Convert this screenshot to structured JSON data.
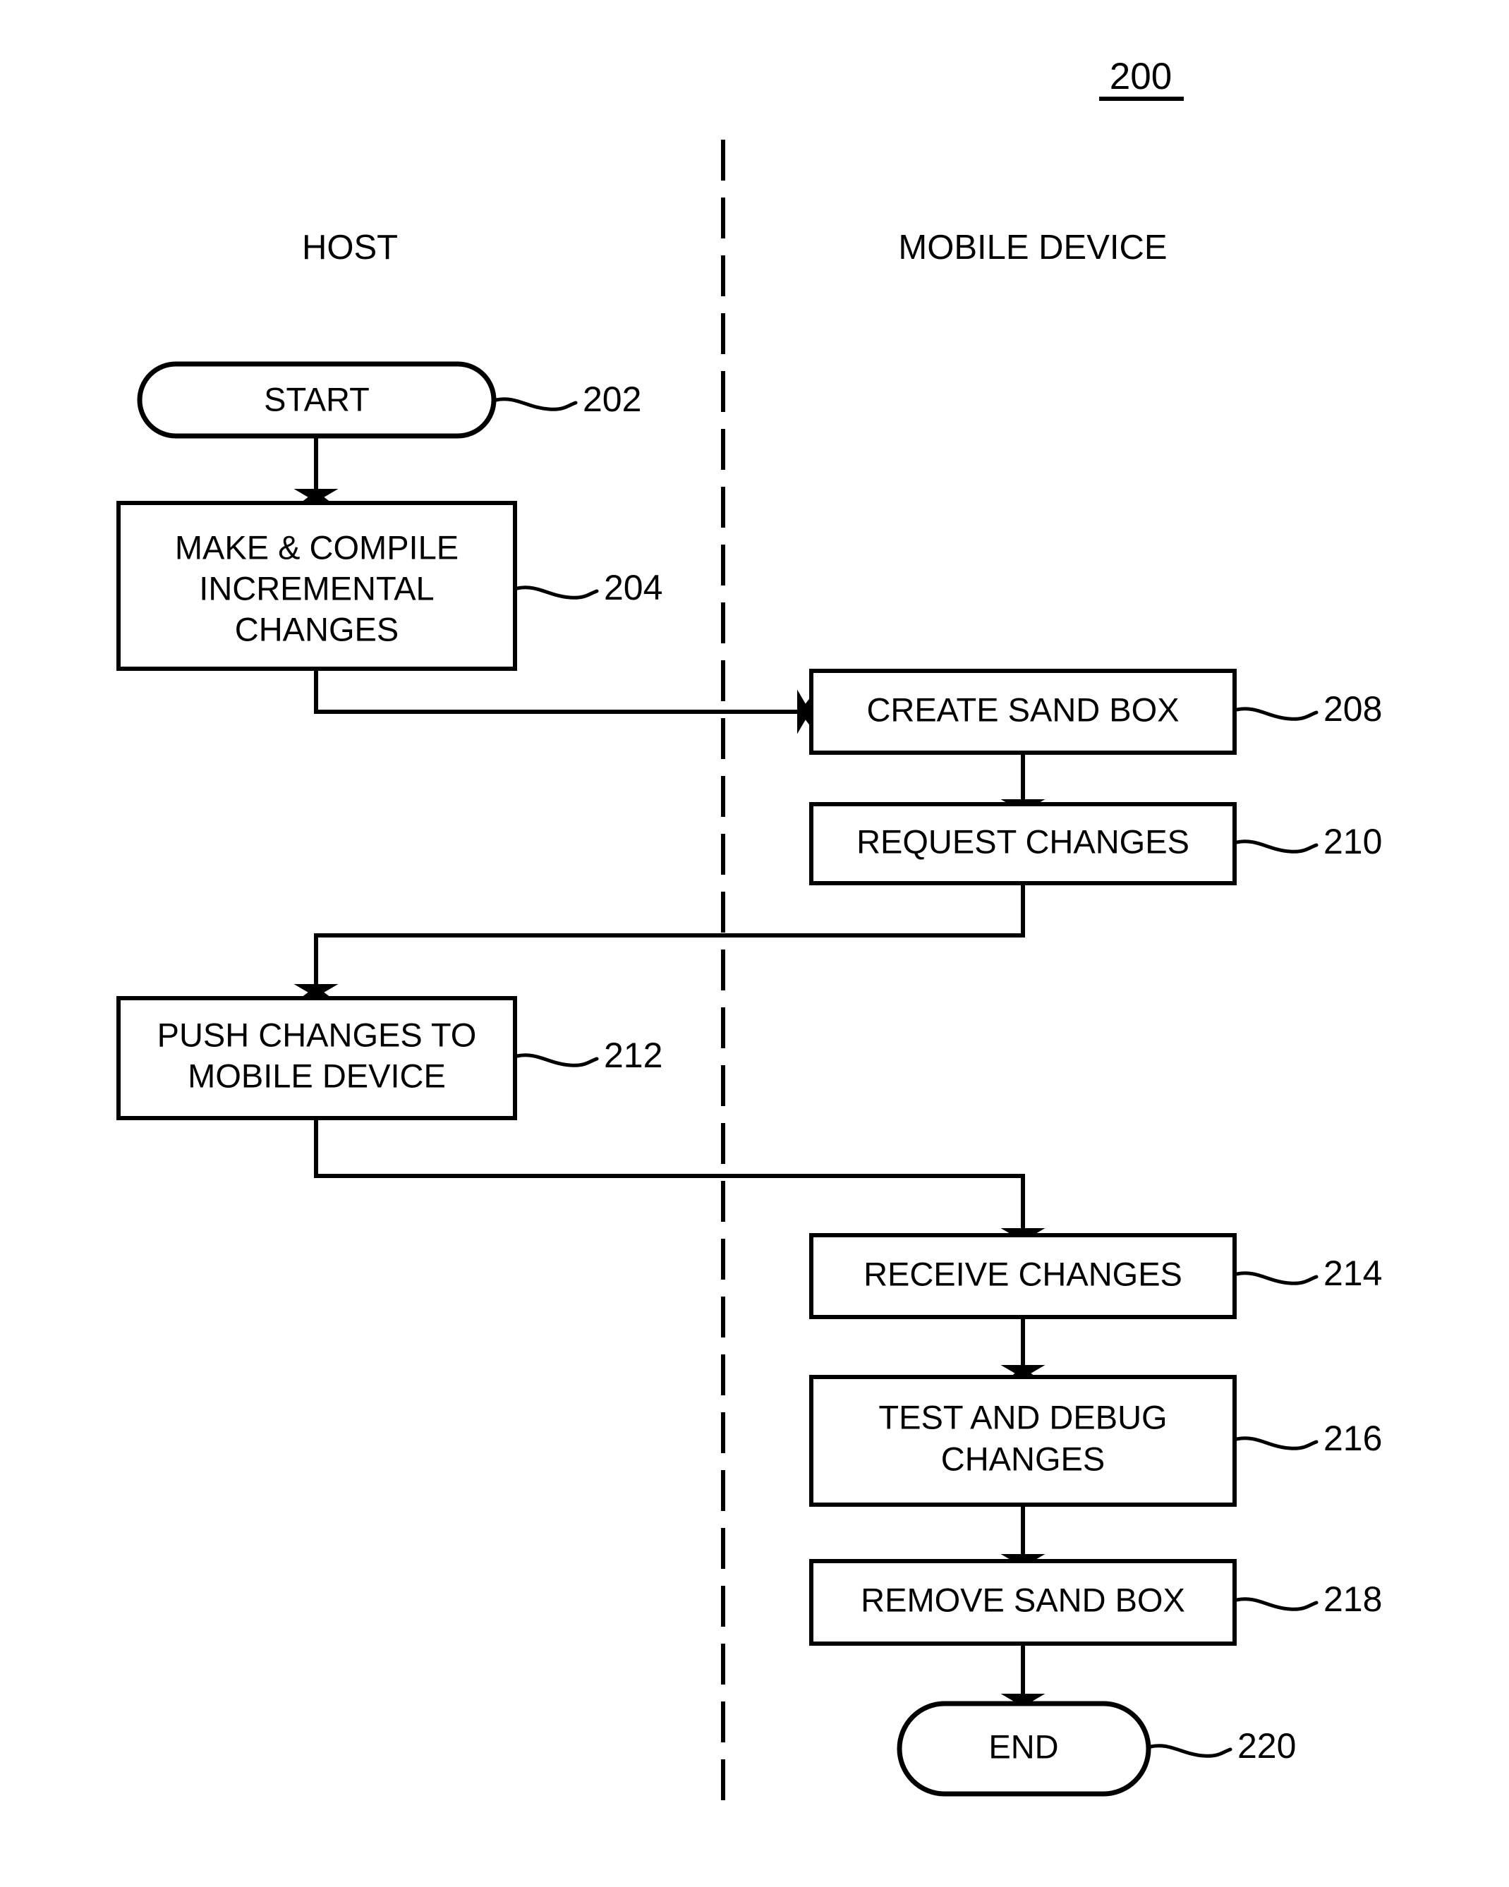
{
  "figure": {
    "number": "200",
    "underlined": true
  },
  "lanes": [
    {
      "id": "host",
      "title": "HOST"
    },
    {
      "id": "mobile",
      "title": "MOBILE DEVICE"
    }
  ],
  "divider": {
    "style": "dashed",
    "orientation": "vertical"
  },
  "nodes": [
    {
      "id": "start",
      "ref": "202",
      "lane": "host",
      "shape": "terminator",
      "lines": [
        "START"
      ]
    },
    {
      "id": "make_compile",
      "ref": "204",
      "lane": "host",
      "shape": "process",
      "lines": [
        "MAKE & COMPILE",
        "INCREMENTAL",
        "CHANGES"
      ]
    },
    {
      "id": "create_sandbox",
      "ref": "208",
      "lane": "mobile",
      "shape": "process",
      "lines": [
        "CREATE SAND BOX"
      ]
    },
    {
      "id": "request_changes",
      "ref": "210",
      "lane": "mobile",
      "shape": "process",
      "lines": [
        "REQUEST CHANGES"
      ]
    },
    {
      "id": "push_changes",
      "ref": "212",
      "lane": "host",
      "shape": "process",
      "lines": [
        "PUSH CHANGES TO",
        "MOBILE DEVICE"
      ]
    },
    {
      "id": "receive_changes",
      "ref": "214",
      "lane": "mobile",
      "shape": "process",
      "lines": [
        "RECEIVE CHANGES"
      ]
    },
    {
      "id": "test_debug",
      "ref": "216",
      "lane": "mobile",
      "shape": "process",
      "lines": [
        "TEST AND DEBUG",
        "CHANGES"
      ]
    },
    {
      "id": "remove_sandbox",
      "ref": "218",
      "lane": "mobile",
      "shape": "process",
      "lines": [
        "REMOVE SAND BOX"
      ]
    },
    {
      "id": "end",
      "ref": "220",
      "lane": "mobile",
      "shape": "terminator",
      "lines": [
        "END"
      ]
    }
  ],
  "edges": [
    {
      "from": "start",
      "to": "make_compile",
      "routing": "straight-down"
    },
    {
      "from": "make_compile",
      "to": "create_sandbox",
      "routing": "down-right-into-left",
      "crosses_lane": true
    },
    {
      "from": "create_sandbox",
      "to": "request_changes",
      "routing": "straight-down"
    },
    {
      "from": "request_changes",
      "to": "push_changes",
      "routing": "down-left-down",
      "crosses_lane": true
    },
    {
      "from": "push_changes",
      "to": "receive_changes",
      "routing": "down-right-down",
      "crosses_lane": true
    },
    {
      "from": "receive_changes",
      "to": "test_debug",
      "routing": "straight-down"
    },
    {
      "from": "test_debug",
      "to": "remove_sandbox",
      "routing": "straight-down"
    },
    {
      "from": "remove_sandbox",
      "to": "end",
      "routing": "straight-down"
    }
  ],
  "colors": {
    "stroke": "#000000",
    "fill": "#ffffff",
    "background": "#ffffff"
  }
}
